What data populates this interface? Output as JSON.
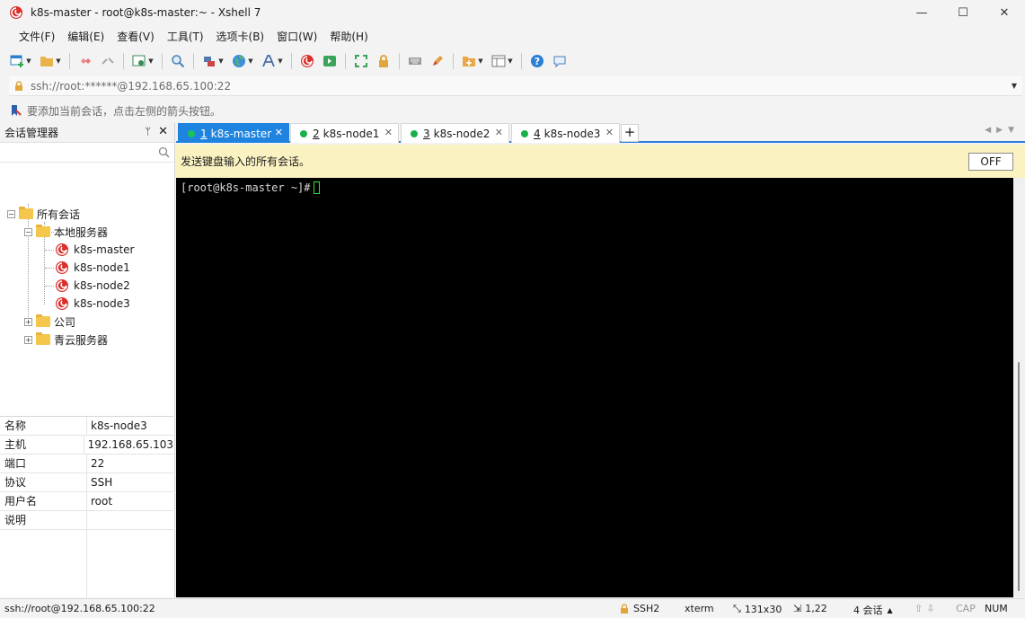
{
  "window": {
    "title": "k8s-master - root@k8s-master:~ - Xshell 7",
    "minimize": "—",
    "maximize": "☐",
    "close": "✕"
  },
  "menu": [
    "文件(F)",
    "编辑(E)",
    "查看(V)",
    "工具(T)",
    "选项卡(B)",
    "窗口(W)",
    "帮助(H)"
  ],
  "address": {
    "value": "ssh://root:******@192.168.65.100:22"
  },
  "hint": {
    "text": "要添加当前会话，点击左侧的箭头按钮。"
  },
  "sidebar": {
    "title": "会话管理器",
    "pin": "ᛘ",
    "close": "✕",
    "tree": {
      "root": "所有会话",
      "local_folder": "本地服务器",
      "sessions": [
        "k8s-master",
        "k8s-node1",
        "k8s-node2",
        "k8s-node3"
      ],
      "company_folder": "公司",
      "cloud_folder": "青云服务器"
    },
    "properties": [
      {
        "key": "名称",
        "value": "k8s-node3"
      },
      {
        "key": "主机",
        "value": "192.168.65.103"
      },
      {
        "key": "端口",
        "value": "22"
      },
      {
        "key": "协议",
        "value": "SSH"
      },
      {
        "key": "用户名",
        "value": "root"
      },
      {
        "key": "说明",
        "value": ""
      }
    ]
  },
  "tabs": [
    {
      "num": "1",
      "label": "k8s-master",
      "active": true
    },
    {
      "num": "2",
      "label": "k8s-node1",
      "active": false
    },
    {
      "num": "3",
      "label": "k8s-node2",
      "active": false
    },
    {
      "num": "4",
      "label": "k8s-node3",
      "active": false
    }
  ],
  "tab_add": "+",
  "sendbar": {
    "message": "发送键盘输入的所有会话。",
    "toggle": "OFF"
  },
  "terminal": {
    "prompt": "[root@k8s-master ~]#"
  },
  "status": {
    "connection": "ssh://root@192.168.65.100:22",
    "protocol": "SSH2",
    "terminal_type": "xterm",
    "size": "131x30",
    "position": "1,22",
    "sessions": "4 会话",
    "cap": "CAP",
    "num": "NUM"
  },
  "colors": {
    "accent": "#1f84e0",
    "connected_dot": "#17b04a",
    "sendbar_bg": "#fbf2c2",
    "terminal_bg": "#000000",
    "cursor": "#2ee62e"
  },
  "icons": {
    "app": "xshell-swirl-icon",
    "session": "xshell-swirl-icon",
    "folder": "folder-icon",
    "lock": "lock-icon",
    "search": "search-icon"
  }
}
